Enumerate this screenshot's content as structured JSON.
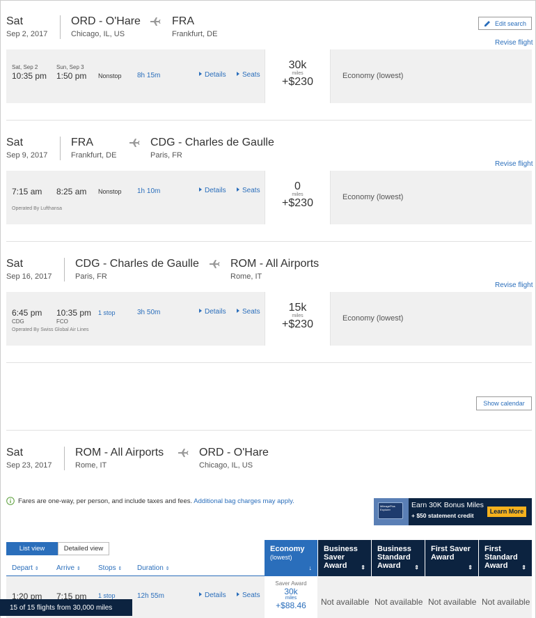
{
  "segments": [
    {
      "day": "Sat",
      "date": "Sep 2, 2017",
      "from_code": "ORD - O'Hare",
      "from_city": "Chicago, IL, US",
      "to_code": "FRA",
      "to_city": "Frankfurt, DE",
      "revise": "Revise flight",
      "flight": {
        "dep_date": "Sat, Sep 2",
        "arr_date": "Sun, Sep 3",
        "dep_time": "10:35 pm",
        "arr_time": "1:50 pm",
        "stops": "Nonstop",
        "duration": "8h 15m",
        "details": "Details",
        "seats": "Seats",
        "miles": "30k",
        "miles_label": "miles",
        "tax": "+$230",
        "cabin": "Economy (lowest)"
      }
    },
    {
      "day": "Sat",
      "date": "Sep 9, 2017",
      "from_code": "FRA",
      "from_city": "Frankfurt, DE",
      "to_code": "CDG - Charles de Gaulle",
      "to_city": "Paris, FR",
      "revise": "Revise flight",
      "flight": {
        "dep_time": "7:15 am",
        "arr_time": "8:25 am",
        "stops": "Nonstop",
        "duration": "1h 10m",
        "operated": "Operated By Lufthansa",
        "details": "Details",
        "seats": "Seats",
        "miles": "0",
        "miles_label": "miles",
        "tax": "+$230",
        "cabin": "Economy (lowest)"
      }
    },
    {
      "day": "Sat",
      "date": "Sep 16, 2017",
      "from_code": "CDG - Charles de Gaulle",
      "from_city": "Paris, FR",
      "to_code": "ROM - All Airports",
      "to_city": "Rome, IT",
      "revise": "Revise flight",
      "flight": {
        "dep_time": "6:45 pm",
        "arr_time": "10:35 pm",
        "dep_airport": "CDG",
        "arr_airport": "FCO",
        "stops": "1 stop",
        "duration": "3h 50m",
        "operated": "Operated By Swiss Global Air Lines",
        "details": "Details",
        "seats": "Seats",
        "miles": "15k",
        "miles_label": "miles",
        "tax": "+$230",
        "cabin": "Economy (lowest)"
      }
    },
    {
      "day": "Sat",
      "date": "Sep 23, 2017",
      "from_code": "ROM - All Airports",
      "from_city": "Rome, IT",
      "to_code": "ORD - O'Hare",
      "to_city": "Chicago, IL, US"
    }
  ],
  "edit_search": "Edit search",
  "show_calendar": "Show calendar",
  "fare_note": {
    "bold": "Fares are one-way,",
    "rest": " per person, and include taxes and fees. ",
    "link": "Additional bag charges may apply."
  },
  "ad": {
    "headline": "Earn 30K Bonus Miles",
    "sub": "+ $50 statement credit",
    "button": "Learn More",
    "card_text": "MileagePlus Explorer"
  },
  "view_toggle": {
    "list": "List view",
    "detailed": "Detailed view"
  },
  "columns": {
    "depart": "Depart",
    "arrive": "Arrive",
    "stops": "Stops",
    "duration": "Duration"
  },
  "fare_columns": [
    {
      "line1": "Economy",
      "line2": "(lowest)",
      "active": true
    },
    {
      "line1": "Business",
      "line2": "Saver",
      "line3": "Award"
    },
    {
      "line1": "Business",
      "line2": "Standard",
      "line3": "Award"
    },
    {
      "line1": "First Saver",
      "line2": "Award"
    },
    {
      "line1": "First",
      "line2": "Standard",
      "line3": "Award"
    }
  ],
  "result_row": {
    "dep_time": "1:20 pm",
    "arr_time": "7:15 pm",
    "stops": "1 stop",
    "duration": "12h 55m",
    "details": "Details",
    "seats": "Seats",
    "award_type": "Saver Award",
    "miles": "30k",
    "miles_label": "miles",
    "tax": "+$88.46",
    "not_available": "Not available"
  },
  "results_count": "15 of 15 flights from 30,000 miles",
  "colors": {
    "navy": "#0c2340",
    "blue": "#2a6ebb",
    "gray_panel": "#f0f0f0",
    "ad_gold": "#f5b11d"
  },
  "icons": [
    "plane-icon",
    "pencil-icon",
    "triangle-right-icon",
    "info-icon",
    "sort-icon",
    "arrow-down-icon"
  ]
}
